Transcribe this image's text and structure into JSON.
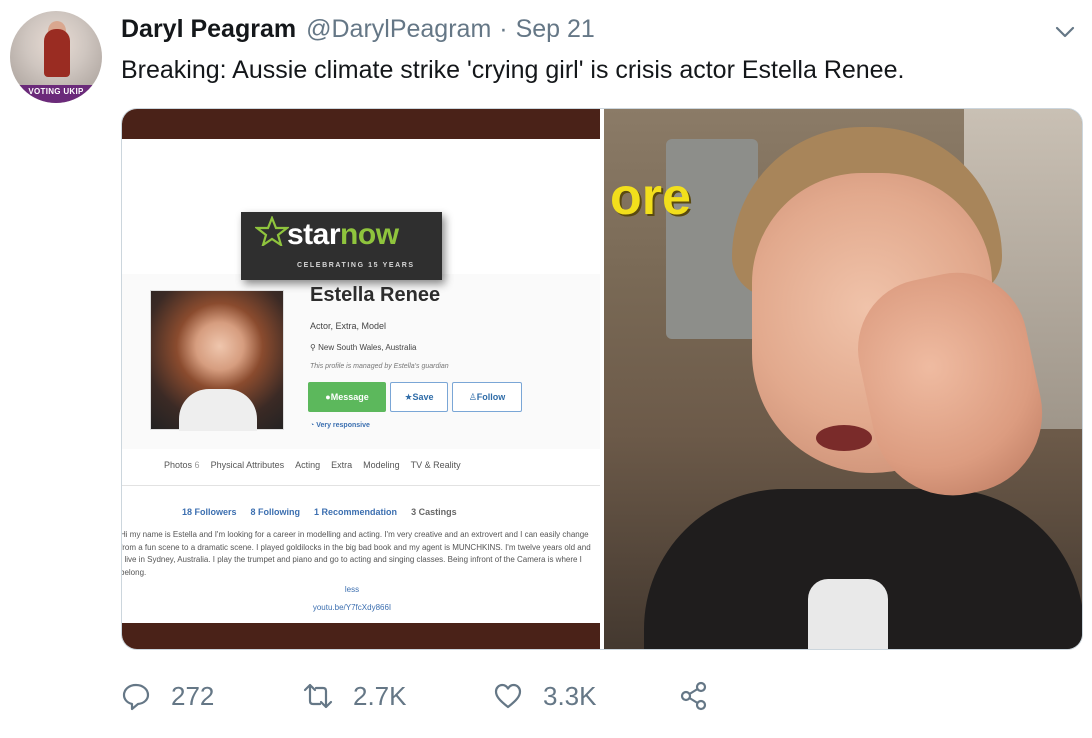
{
  "tweet": {
    "avatar_banner": "VOTING UKIP",
    "display_name": "Daryl Peagram",
    "handle": "@DarylPeagram",
    "separator": "·",
    "date": "Sep 21",
    "text": "Breaking: Aussie climate strike 'crying girl' is crisis actor Estella Renee."
  },
  "media": {
    "left": {
      "logo_prefix": "star",
      "logo_suffix": "now",
      "logo_tagline": "CELEBRATING 15 YEARS",
      "profile_name": "Estella Renee",
      "roles": "Actor, Extra, Model",
      "location": "New South Wales, Australia",
      "managed_note": "This profile is managed by Estella's guardian",
      "buttons": {
        "message": "Message",
        "save": "Save",
        "follow": "Follow"
      },
      "responsive": "Very responsive",
      "tabs": [
        {
          "label": "Photos",
          "count": "6"
        },
        {
          "label": "Physical Attributes",
          "count": ""
        },
        {
          "label": "Acting",
          "count": ""
        },
        {
          "label": "Extra",
          "count": ""
        },
        {
          "label": "Modeling",
          "count": ""
        },
        {
          "label": "TV & Reality",
          "count": ""
        }
      ],
      "stats": {
        "followers": "18 Followers",
        "following": "8 Following",
        "recommendation": "1 Recommendation",
        "castings": "3 Castings"
      },
      "bio": "Hi my name is Estella and I'm looking for a career in modelling and acting. I'm very creative and an extrovert and I can easily change from a fun scene to a dramatic scene. I played goldilocks in the big bad book and my agent is MUNCHKINS. I'm twelve years old and I live in Sydney, Australia. I play the trumpet and piano and go to acting and singing classes. Being infront of the Camera is where I belong.",
      "less": "less",
      "link": "youtu.be/Y7fcXdy866I"
    },
    "right": {
      "caption_fragment": "ore"
    }
  },
  "actions": {
    "replies": "272",
    "retweets": "2.7K",
    "likes": "3.3K"
  },
  "colors": {
    "text_primary": "#14171a",
    "text_secondary": "#657786",
    "border": "#ccd6dd",
    "starnow_green": "#8fc43d",
    "message_green": "#5cb85c",
    "strip_brown": "#4a2218"
  },
  "icons": {
    "reply": "reply-icon",
    "retweet": "retweet-icon",
    "like": "heart-icon",
    "share": "share-icon",
    "menu": "chevron-down-icon"
  }
}
